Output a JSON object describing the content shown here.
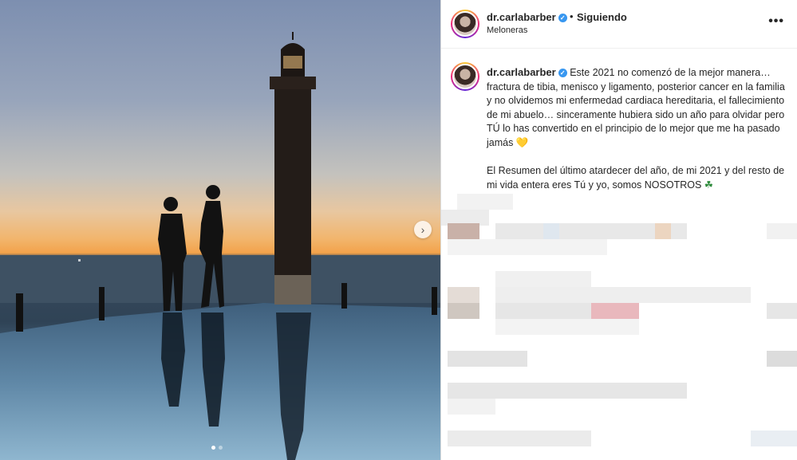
{
  "post": {
    "username": "dr.carlabarber",
    "verified_glyph": "✓",
    "separator": "•",
    "follow_label": "Siguiendo",
    "location": "Meloneras",
    "more_label": "•••"
  },
  "caption": {
    "username": "dr.carlabarber",
    "paragraph1": "Este 2021 no comenzó de la mejor manera… fractura de tibia, menisco y ligamento, posterior cancer en la familia y no olvidemos mi enfermedad cardiaca hereditaria, el fallecimiento de mi abuelo… sinceramente hubiera sido un año para olvidar pero TÚ lo has convertido en el principio de lo mejor que me ha pasado jamás",
    "heart_emoji": "💛",
    "paragraph2": "El Resumen del último atardecer del año, de mi 2021 y del resto de mi vida entera eres Tú y yo, somos NOSOTROS",
    "clover_emoji": "☘"
  },
  "carousel": {
    "next_glyph": "›",
    "slide_count": 2,
    "active_slide": 1
  },
  "icons": [
    "chevron-right-icon",
    "verified-badge-icon",
    "more-options-icon"
  ]
}
